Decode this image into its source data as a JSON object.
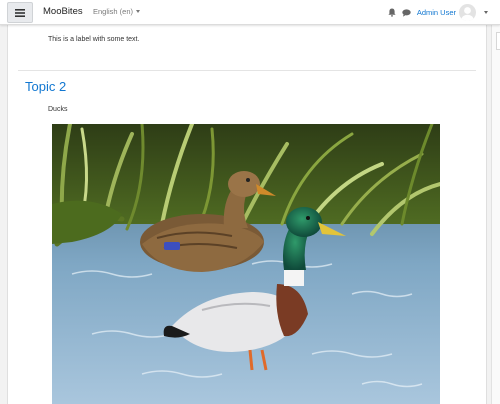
{
  "navbar": {
    "brand": "MooBites",
    "language": "English (en)",
    "user_name": "Admin User",
    "icons": [
      "menu-icon",
      "bell-icon",
      "comment-icon",
      "avatar",
      "chevron-down-icon"
    ]
  },
  "content": {
    "label_text": "This is a label with some text.",
    "section_title": "Topic 2",
    "image_caption": "Ducks",
    "image_subject": "Mallard duck pair standing in a shallow stream"
  },
  "colors": {
    "link": "#1177d1",
    "navbar_bg": "#ffffff",
    "page_bg": "#f2f2f2"
  }
}
